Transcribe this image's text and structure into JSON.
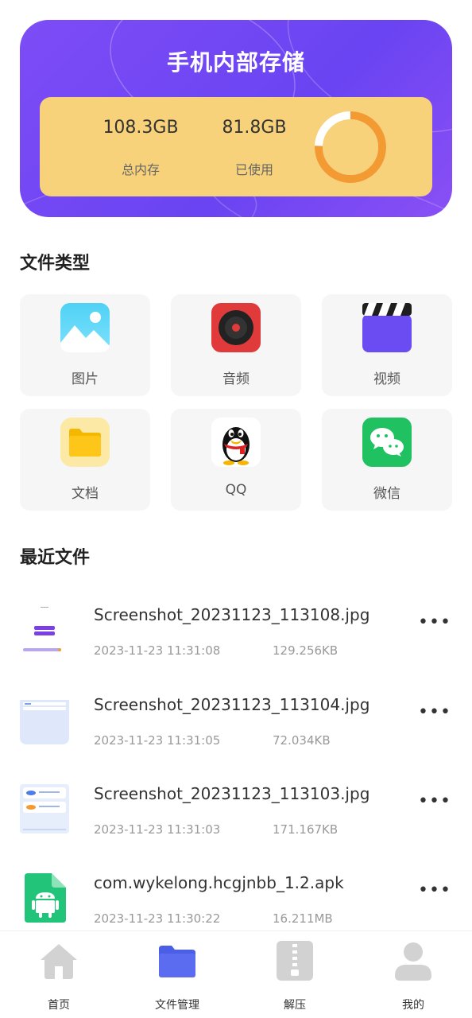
{
  "storage": {
    "title": "手机内部存储",
    "total_value": "108.3GB",
    "total_label": "总内存",
    "used_value": "81.8GB",
    "used_label": "已使用",
    "used_fraction": 0.755,
    "ring_color": "#f39a32",
    "card_color": "#7b4bf6"
  },
  "file_types": {
    "title": "文件类型",
    "items": [
      {
        "label": "图片",
        "icon": "image-icon"
      },
      {
        "label": "音频",
        "icon": "music-disc-icon"
      },
      {
        "label": "视频",
        "icon": "video-clapper-icon"
      },
      {
        "label": "文档",
        "icon": "folder-icon"
      },
      {
        "label": "QQ",
        "icon": "qq-penguin-icon"
      },
      {
        "label": "微信",
        "icon": "wechat-icon"
      }
    ]
  },
  "recent": {
    "title": "最近文件",
    "more_label": "•••",
    "files": [
      {
        "name": "Screenshot_20231123_113108.jpg",
        "date": "2023-11-23 11:31:08",
        "size": "129.256KB",
        "thumb": "screenshot-thumbnail"
      },
      {
        "name": "Screenshot_20231123_113104.jpg",
        "date": "2023-11-23 11:31:05",
        "size": "72.034KB",
        "thumb": "screenshot-thumbnail"
      },
      {
        "name": "Screenshot_20231123_113103.jpg",
        "date": "2023-11-23 11:31:03",
        "size": "171.167KB",
        "thumb": "screenshot-thumbnail"
      },
      {
        "name": "com.wykelong.hcgjnbb_1.2.apk",
        "date": "2023-11-23 11:30:22",
        "size": "16.211MB",
        "thumb": "android-apk-icon"
      }
    ]
  },
  "nav": {
    "items": [
      {
        "label": "首页",
        "icon": "home-icon",
        "active": false
      },
      {
        "label": "文件管理",
        "icon": "folder-icon",
        "active": true
      },
      {
        "label": "解压",
        "icon": "zip-icon",
        "active": false
      },
      {
        "label": "我的",
        "icon": "user-icon",
        "active": false
      }
    ],
    "active_color": "#5b6cf0",
    "inactive_color": "#d2d2d2"
  }
}
